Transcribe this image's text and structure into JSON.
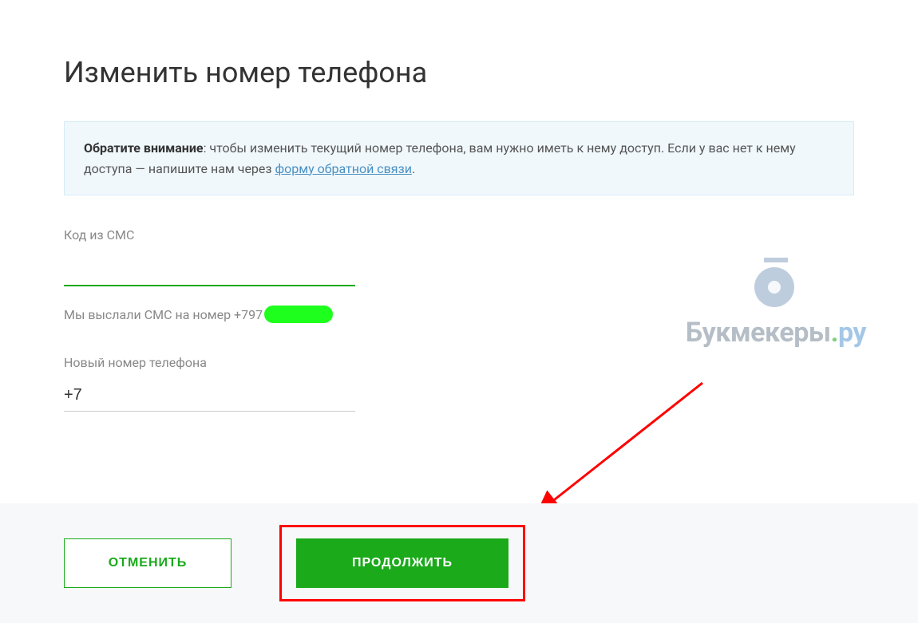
{
  "page": {
    "title": "Изменить номер телефона"
  },
  "notice": {
    "strong": "Обратите внимание",
    "text_before": ": чтобы изменить текущий номер телефона, вам нужно иметь к нему доступ. Если у вас нет к нему доступа — напишите нам через ",
    "link_text": "форму обратной связи",
    "text_after": "."
  },
  "fields": {
    "sms_code_label": "Код из СМС",
    "sms_sent_prefix": "Мы выслали СМС на номер +797",
    "new_phone_label": "Новый номер телефона",
    "new_phone_value": "+7"
  },
  "buttons": {
    "cancel": "ОТМЕНИТЬ",
    "continue": "ПРОДОЛЖИТЬ"
  },
  "watermark": {
    "text_main": "Букмекеры",
    "dot": ".",
    "text_ru": "ру"
  }
}
